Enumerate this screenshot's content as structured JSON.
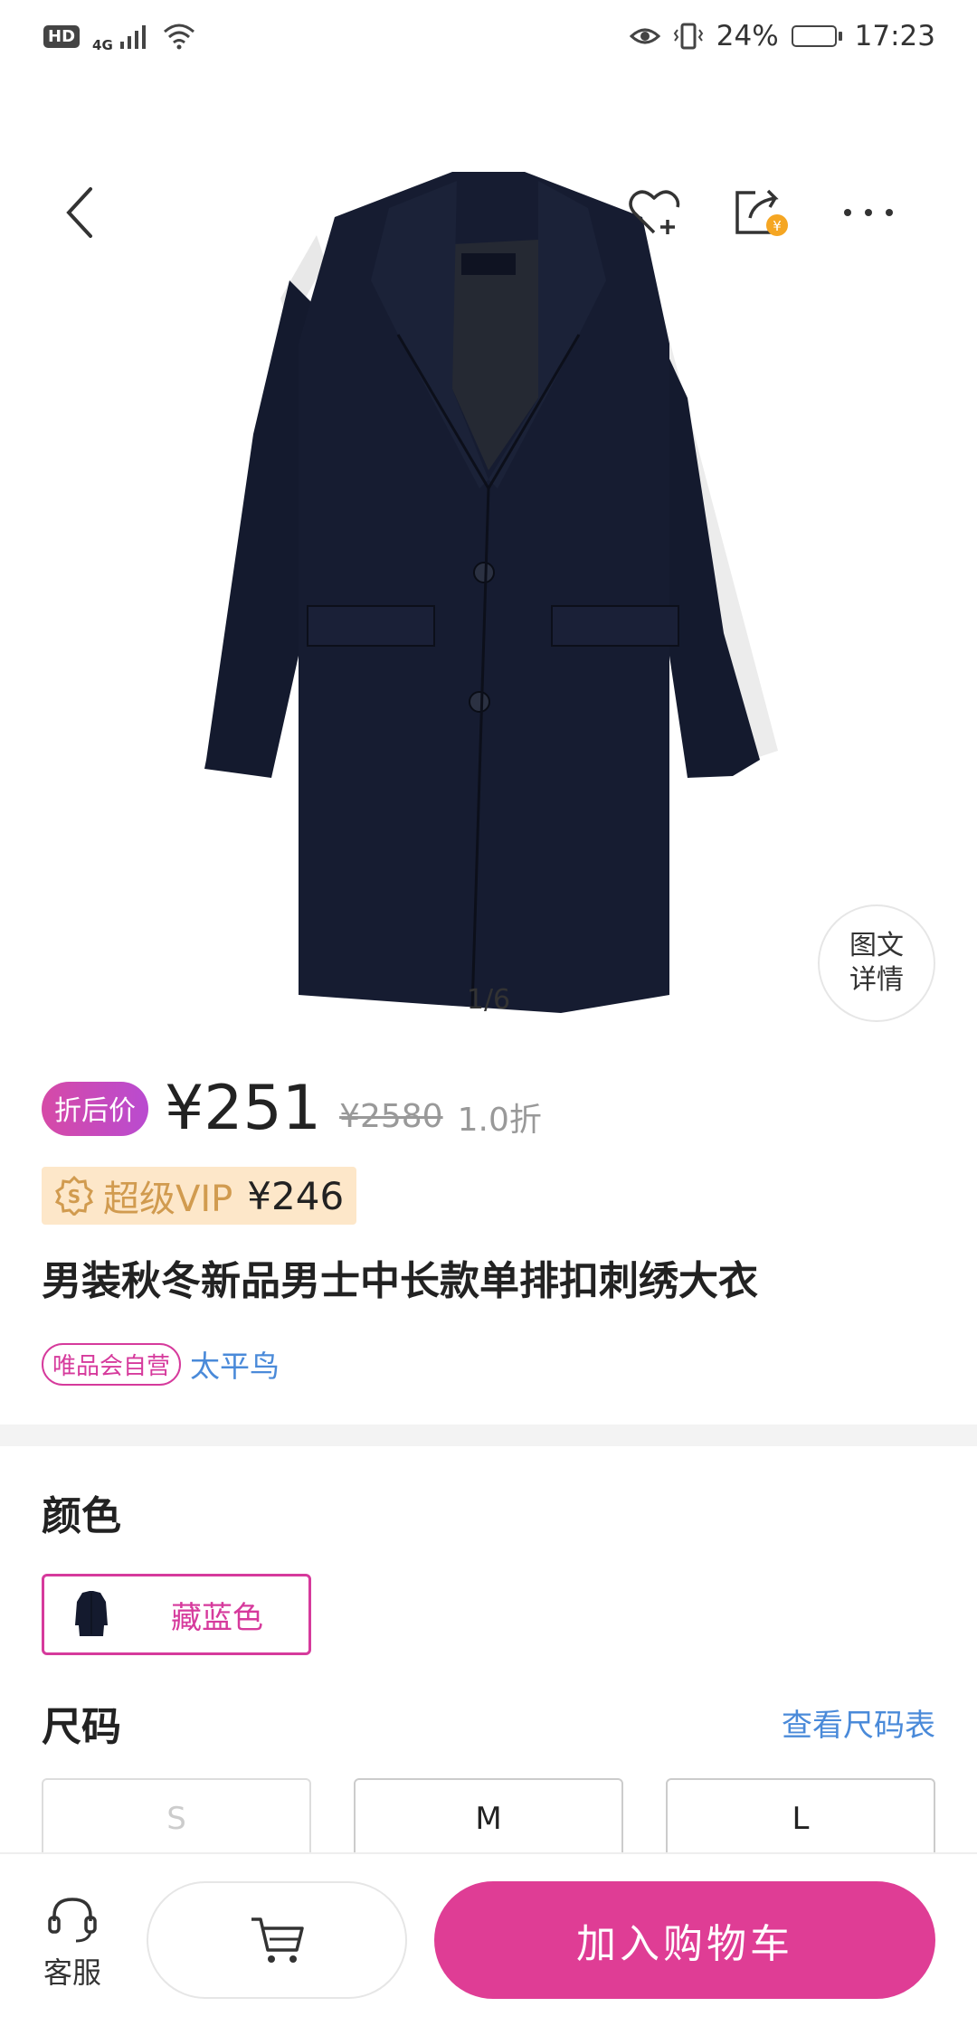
{
  "status_bar": {
    "hd": "HD",
    "network": "4G",
    "battery_percent": "24%",
    "battery_level": 0.24,
    "time": "17:23"
  },
  "nav": {
    "icons": [
      "back-arrow-icon",
      "favorite-heart-icon",
      "share-icon",
      "more-icon"
    ]
  },
  "gallery": {
    "page_indicator": "1/6",
    "detail_bubble": [
      "图文",
      "详情"
    ]
  },
  "price": {
    "discount_label": "折后价",
    "current": "¥251",
    "original": "¥2580",
    "rate": "1.0折"
  },
  "vip": {
    "label": "超级VIP",
    "price": "¥246"
  },
  "product": {
    "title": "男装秋冬新品男士中长款单排扣刺绣大衣",
    "store_badge": "唯品会自营",
    "brand": "太平鸟"
  },
  "options": {
    "color_title": "颜色",
    "colors": [
      {
        "label": "藏蓝色",
        "selected": true
      }
    ],
    "size_title": "尺码",
    "size_chart_link": "查看尺码表",
    "sizes": [
      {
        "label": "S",
        "available": false
      },
      {
        "label": "M",
        "available": true
      },
      {
        "label": "L",
        "available": true
      }
    ]
  },
  "bottom_bar": {
    "service_label": "客服",
    "add_to_cart": "加入购物车"
  },
  "colors": {
    "accent": "#df3d95",
    "link": "#4a8ad9",
    "vip_bg": "#fde7c9",
    "vip_text": "#d19b4f",
    "coat": "#141a2e"
  }
}
